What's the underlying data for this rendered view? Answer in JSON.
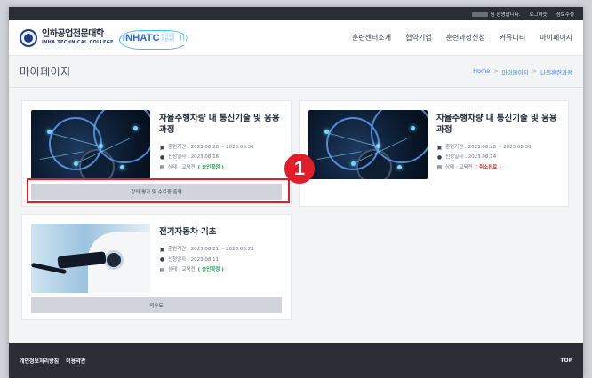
{
  "topbar": {
    "welcome": "님 환영합니다.",
    "logout": "로그아웃",
    "myinfo": "정보수정"
  },
  "header": {
    "logo_ko": "인하공업전문대학",
    "logo_en": "INHA TECHNICAL COLLEGE",
    "brand": "INHATC",
    "brand_sub": "인하공업전문대학"
  },
  "nav": {
    "items": [
      "훈련센터소개",
      "협약기업",
      "훈련과정신청",
      "커뮤니티",
      "마이페이지"
    ]
  },
  "page": {
    "title": "마이페이지",
    "breadcrumb": [
      "Home",
      "마이페이지",
      "나의훈련과정"
    ]
  },
  "courses": [
    {
      "title": "자율주행차량 내 통신기술 및 응용과정",
      "period": "훈련기간 : 2023.08.28 ~ 2023.08.30",
      "applied": "신청일자 : 2023.08.16",
      "status_label": "상태 : 교육전",
      "status_value": "( 승인확정 )",
      "button": "강의 평가 및 수료증 출력"
    },
    {
      "title": "자율주행차량 내 통신기술 및 응용과정",
      "period": "훈련기간 : 2023.08.28 ~ 2023.08.30",
      "applied": "신청일자 : 2023.08.14",
      "status_label": "상태 : 교육전",
      "status_value": "( 취소완료 )"
    },
    {
      "title": "전기자동차 기초",
      "period": "훈련기간 : 2023.08.21 ~ 2023.08.23",
      "applied": "신청일자 : 2023.08.11",
      "status_label": "상태 : 교육전",
      "status_value": "( 승인확정 )",
      "button": "미수료"
    }
  ],
  "annotation": {
    "marker": "1"
  },
  "footer": {
    "privacy": "개인정보처리방침",
    "terms": "이용약관",
    "top": "TOP"
  },
  "colors": {
    "accent_blue": "#3b82f6",
    "highlight_red": "#e11d2a",
    "status_green": "#16a34a",
    "status_red": "#dc2626"
  }
}
